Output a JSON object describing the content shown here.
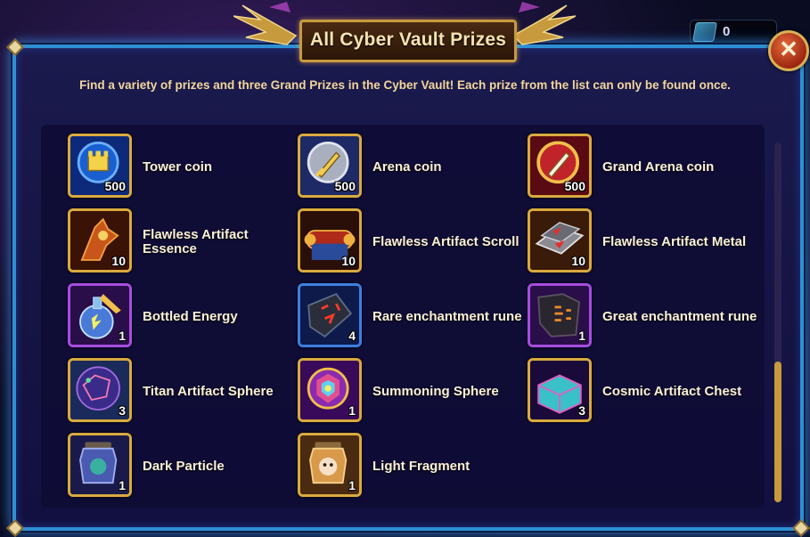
{
  "dialog": {
    "title": "All Cyber Vault Prizes",
    "description": "Find a variety of prizes and three Grand Prizes in the Cyber Vault!  Each prize from the list can only be found once.",
    "close_label": "✕"
  },
  "currency": {
    "value": "0",
    "icon": "ticket-icon"
  },
  "prizes": [
    {
      "label": "Tower coin",
      "qty": "500",
      "icon": "tower-coin-icon",
      "color": "#1a5fd0"
    },
    {
      "label": "Arena coin",
      "qty": "500",
      "icon": "arena-coin-icon",
      "color": "#9aa4b8"
    },
    {
      "label": "Grand Arena coin",
      "qty": "500",
      "icon": "grand-arena-coin-icon",
      "color": "#c0242a"
    },
    {
      "label": "Flawless Artifact Essence",
      "qty": "10",
      "icon": "artifact-essence-icon",
      "color": "#c8561a"
    },
    {
      "label": "Flawless Artifact Scroll",
      "qty": "10",
      "icon": "artifact-scroll-icon",
      "color": "#c8561a"
    },
    {
      "label": "Flawless Artifact Metal",
      "qty": "10",
      "icon": "artifact-metal-icon",
      "color": "#c8561a"
    },
    {
      "label": "Bottled Energy",
      "qty": "1",
      "icon": "bottled-energy-icon",
      "color": "#4a7ad8"
    },
    {
      "label": "Rare enchantment rune",
      "qty": "4",
      "icon": "rare-rune-icon",
      "color": "#2a4aa0"
    },
    {
      "label": "Great enchantment rune",
      "qty": "1",
      "icon": "great-rune-icon",
      "color": "#5a2a90"
    },
    {
      "label": "Titan Artifact Sphere",
      "qty": "3",
      "icon": "titan-sphere-icon",
      "color": "#3a2a8a"
    },
    {
      "label": "Summoning Sphere",
      "qty": "1",
      "icon": "summoning-sphere-icon",
      "color": "#8a2ab0"
    },
    {
      "label": "Cosmic Artifact Chest",
      "qty": "3",
      "icon": "cosmic-chest-icon",
      "color": "#3ac0c8"
    },
    {
      "label": "Dark Particle",
      "qty": "1",
      "icon": "dark-particle-icon",
      "color": "#2a3a90"
    },
    {
      "label": "Light Fragment",
      "qty": "1",
      "icon": "light-fragment-icon",
      "color": "#d89a4a"
    }
  ]
}
